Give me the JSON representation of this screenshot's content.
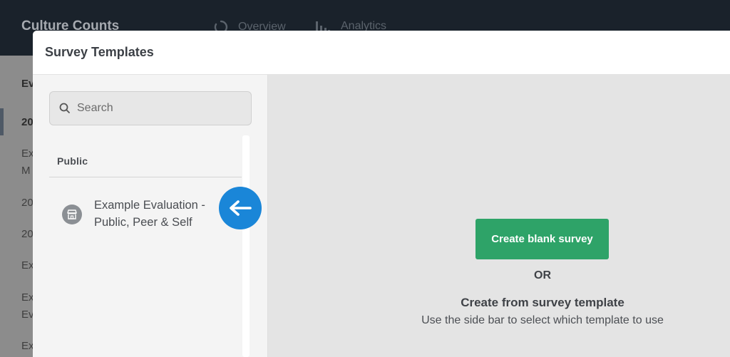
{
  "app": {
    "brand": "Culture Counts",
    "nav": [
      {
        "label": "Overview",
        "icon": "loading-circle-icon"
      },
      {
        "label": "Analytics",
        "icon": "bar-chart-icon"
      }
    ],
    "sidebar_fragments": [
      "Ev",
      "20",
      "Ex",
      "M",
      "20",
      "20",
      "Ex",
      "Ex",
      "Ev",
      "Ex"
    ]
  },
  "modal": {
    "title": "Survey Templates",
    "search": {
      "placeholder": "Search",
      "value": ""
    },
    "section_label": "Public",
    "templates": [
      {
        "label": "Example Evaluation - Public, Peer & Self",
        "icon": "storefront-icon"
      }
    ],
    "create_button": "Create blank survey",
    "or_text": "OR",
    "template_heading": "Create from survey template",
    "template_sub": "Use the side bar to select which template to use"
  },
  "colors": {
    "topbar": "#1a222b",
    "primary_button": "#2ea368",
    "callout": "#1a86d8"
  }
}
